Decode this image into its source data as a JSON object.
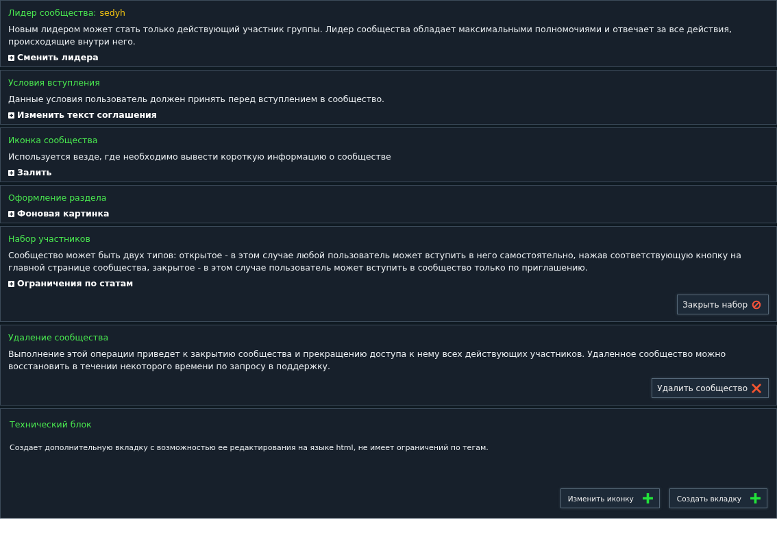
{
  "sections": [
    {
      "kind": "standard",
      "title": "Лидер сообщества:",
      "highlight": "sedyh",
      "description": "Новым лидером может стать только действующий участник группы. Лидер сообщества обладает максимальными полномочиями и отвечает за все действия, происходящие внутри него.",
      "links": [
        "Сменить лидера"
      ]
    },
    {
      "kind": "standard",
      "title": "Условия вступления",
      "description": "Данные условия пользователь должен принять перед вступлением в сообщество.",
      "links": [
        "Изменить текст соглашения"
      ]
    },
    {
      "kind": "standard",
      "title": "Иконка сообщества",
      "description": "Используется везде, где необходимо вывести короткую информацию о сообществе",
      "links": [
        "Залить"
      ]
    },
    {
      "kind": "standard",
      "title": "Оформление раздела",
      "links": [
        "Фоновая картинка"
      ]
    },
    {
      "kind": "standard",
      "title": "Набор участников",
      "description": "Сообщество может быть двух типов: открытое - в этом случае любой пользователь может вступить в него самостоятельно, нажав соответствующую кнопку на главной странице сообщества, закрытое - в этом случае пользователь может вступить в сообщество только по приглашению.",
      "links": [
        "Ограничения по статам"
      ],
      "buttons": [
        {
          "label": "Закрыть набор",
          "kind": "forbid"
        }
      ]
    },
    {
      "kind": "standard",
      "title": "Удаление сообщества",
      "description": "Выполнение этой операции приведет к закрытию сообщества и прекращению доступа к нему всех действующих участников. Удаленное сообщество можно восстановить в течении некоторого времени по запросу в поддержку.",
      "buttons": [
        {
          "label": "Удалить сообщество",
          "kind": "cross"
        }
      ]
    },
    {
      "kind": "technical",
      "title": "Технический блок",
      "description": "Создает дополнительную вкладку с возможностью ее редактирования на языке html, не имеет ограничений по тегам.",
      "buttons": [
        {
          "label": "Изменить иконку",
          "kind": "plus"
        },
        {
          "label": "Создать вкладку",
          "kind": "plus"
        }
      ]
    }
  ]
}
